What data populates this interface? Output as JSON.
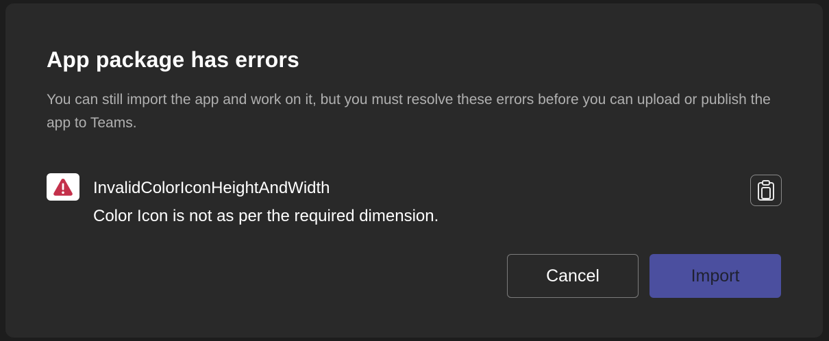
{
  "dialog": {
    "title": "App package has errors",
    "description": "You can still import the app and work on it, but you must resolve these errors before you can upload or publish the app to Teams.",
    "errors": [
      {
        "icon": "warning-icon",
        "code": "InvalidColorIconHeightAndWidth",
        "message": "Color Icon is not as per the required dimension."
      }
    ],
    "copy_icon": "copy-icon",
    "buttons": {
      "cancel_label": "Cancel",
      "import_label": "Import"
    }
  },
  "colors": {
    "dialog_background": "#292929",
    "primary_button": "#4b4f9f",
    "error_icon": "#c4314b"
  }
}
